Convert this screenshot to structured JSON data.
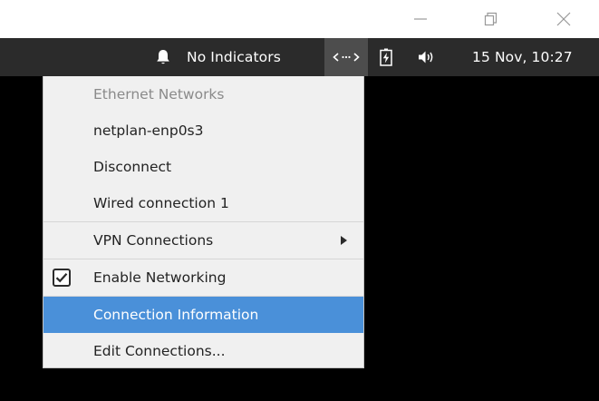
{
  "panel": {
    "indicators_label": "No Indicators",
    "network_indicator_glyph": "<··>",
    "clock": "15 Nov, 10:27"
  },
  "icons": {
    "bell": "bell-icon",
    "network": "network-indicator-icon",
    "battery": "battery-charging-icon",
    "volume": "volume-icon",
    "minimize": "minimize-icon",
    "maximize": "maximize-icon",
    "close": "close-icon"
  },
  "menu": {
    "items": [
      {
        "label": "Ethernet Networks"
      },
      {
        "label": "netplan-enp0s3"
      },
      {
        "label": "Disconnect"
      },
      {
        "label": "Wired connection 1"
      },
      {
        "label": "VPN Connections"
      },
      {
        "label": "Enable Networking",
        "checked": true
      },
      {
        "label": "Connection Information",
        "selected": true
      },
      {
        "label": "Edit Connections..."
      }
    ]
  },
  "colors": {
    "panel_bg": "#2b2b2b",
    "menu_bg": "#f0f0f0",
    "selection": "#4a90d9",
    "header_text": "#8a8a8a"
  }
}
